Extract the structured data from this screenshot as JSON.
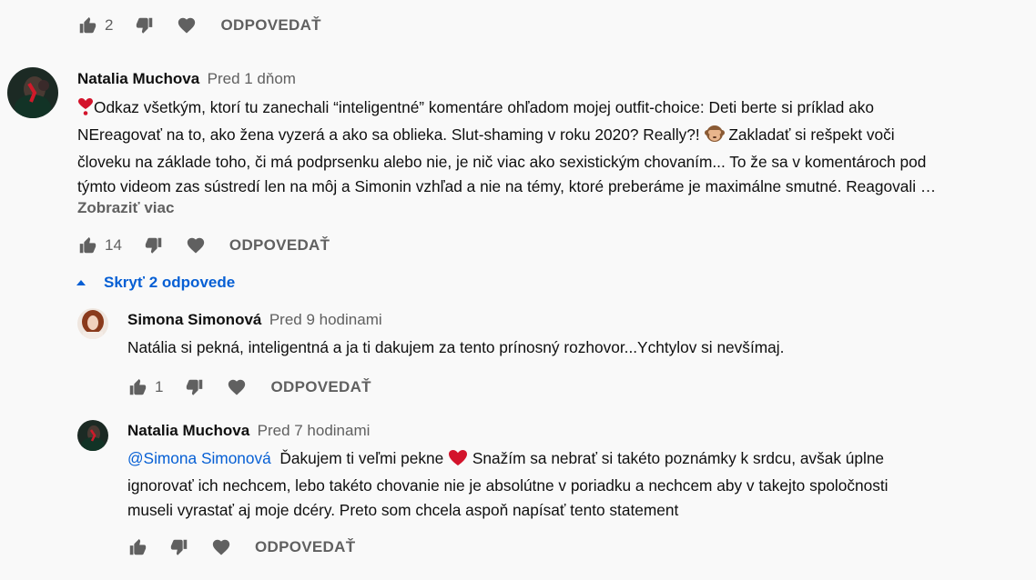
{
  "labels": {
    "reply": "ODPOVEDAŤ"
  },
  "colors": {
    "link": "#065fd4",
    "secondary_text": "#606060",
    "background": "#f9f9f9",
    "heart_red": "#d3132b"
  },
  "top_actions": {
    "like_count": "2"
  },
  "comment": {
    "author": "Natalia Muchova",
    "time": "Pred 1 dňom",
    "text_p1": "Odkaz všetkým, ktorí tu zanechali “inteligentné” komentáre ohľadom mojej outfit-choice: Deti berte si príklad ako",
    "text_p2": "NEreagovať na to, ako žena vyzerá a ako sa oblieka. Slut-shaming v roku 2020? Really?!",
    "text_p3": "Zakladať si rešpekt voči",
    "text_p4": "človeku na základe toho, či má podprsenku alebo nie, je nič viac ako sexistickým chovaním... To že sa v komentároch pod",
    "text_p5": "týmto videom zas sústredí len na môj a Simonin vzhľad a nie na témy, ktoré preberáme je maximálne smutné. Reagovali …",
    "show_more": "Zobraziť viac",
    "like_count": "14",
    "icons": [
      "heart-exclamation-emoji",
      "see-no-evil-monkey-emoji"
    ]
  },
  "hide_replies": "Skryť 2 odpovede",
  "replies": [
    {
      "author": "Simona Simonová",
      "time": "Pred 9 hodinami",
      "text": "Natália si pekná, inteligentná a ja ti dakujem za tento prínosný rozhovor...Ychtylov si nevšímaj.",
      "like_count": "1"
    },
    {
      "author": "Natalia Muchova",
      "time": "Pred 7 hodinami",
      "mention": "@Simona Simonová",
      "text_a": "Ďakujem ti veľmi pekne",
      "text_b": "Snažím sa nebrať si takéto poznámky k srdcu, avšak úplne",
      "text_line2": "ignorovať ich nechcem, lebo takéto chovanie nie je absolútne v poriadku a nechcem aby v takejto spoločnosti",
      "text_line3": "museli vyrastať aj moje dcéry. Preto som chcela aspoň napísať tento statement",
      "like_count": ""
    }
  ]
}
